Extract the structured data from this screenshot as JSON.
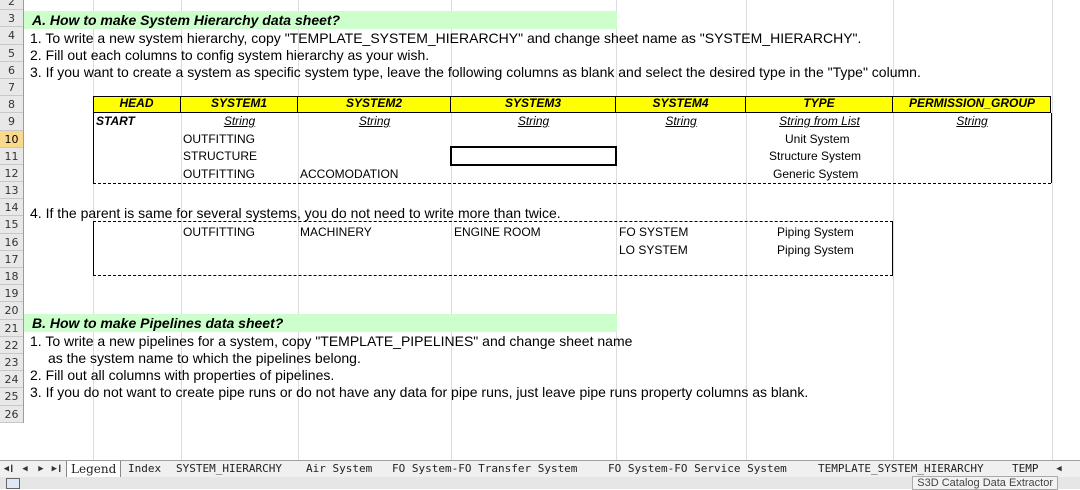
{
  "row_numbers": [
    "2",
    "3",
    "4",
    "5",
    "6",
    "7",
    "8",
    "9",
    "10",
    "11",
    "12",
    "13",
    "14",
    "15",
    "16",
    "17",
    "18",
    "19",
    "20",
    "21",
    "22",
    "23",
    "24",
    "25",
    "26"
  ],
  "selected_row": "10",
  "sectionA": {
    "title": "A. How to make System Hierarchy data sheet?",
    "line1": "1. To write a new system hierarchy, copy \"TEMPLATE_SYSTEM_HIERARCHY\"  and change sheet name as \"SYSTEM_HIERARCHY\".",
    "line2": "2.  Fill out each columns to config system hierarchy as your wish.",
    "line3": "3. If you want to create a system as specific system type, leave the following columns as blank and select the desired type in the \"Type\" column.",
    "line4": "4. If the parent is same for several systems, you do not need to write more than twice."
  },
  "table1": {
    "headers": [
      "HEAD",
      "SYSTEM1",
      "SYSTEM2",
      "SYSTEM3",
      "SYSTEM4",
      "TYPE",
      "PERMISSION_GROUP"
    ],
    "types": [
      "String",
      "String",
      "String",
      "String",
      "String from List",
      "String"
    ],
    "start_label": "START",
    "rows": [
      {
        "system1": "OUTFITTING",
        "system2": "",
        "type": "Unit System"
      },
      {
        "system1": "STRUCTURE",
        "system2": "",
        "type": "Structure System"
      },
      {
        "system1": "OUTFITTING",
        "system2": "ACCOMODATION",
        "type": "Generic System"
      }
    ]
  },
  "table2": {
    "rows": [
      {
        "system1": "OUTFITTING",
        "system2": "MACHINERY",
        "system3": "ENGINE ROOM",
        "system4": "FO SYSTEM",
        "type": "Piping System"
      },
      {
        "system1": "",
        "system2": "",
        "system3": "",
        "system4": "LO SYSTEM",
        "type": "Piping System"
      }
    ]
  },
  "sectionB": {
    "title": "B. How to make Pipelines data sheet?",
    "line1": "1. To write a new pipelines for a system, copy \"TEMPLATE_PIPELINES\"  and change sheet name",
    "line1b": "as the system name to which the pipelines belong.",
    "line2": "2.  Fill out all columns with properties of pipelines.",
    "line3": "3. If you do not want to create pipe runs or do not have any data for pipe runs,  just leave pipe runs property columns as blank."
  },
  "tabs": [
    "Legend",
    "Index",
    "SYSTEM_HIERARCHY",
    "Air System",
    "FO System-FO Transfer System",
    "FO System-FO Service System",
    "TEMPLATE_SYSTEM_HIERARCHY",
    "TEMP"
  ],
  "status_text": "S3D Catalog Data Extractor",
  "colors": {
    "title_bg": "#ccffcc",
    "header_bg": "#ffff00",
    "selected_row": "#f9d98c"
  }
}
